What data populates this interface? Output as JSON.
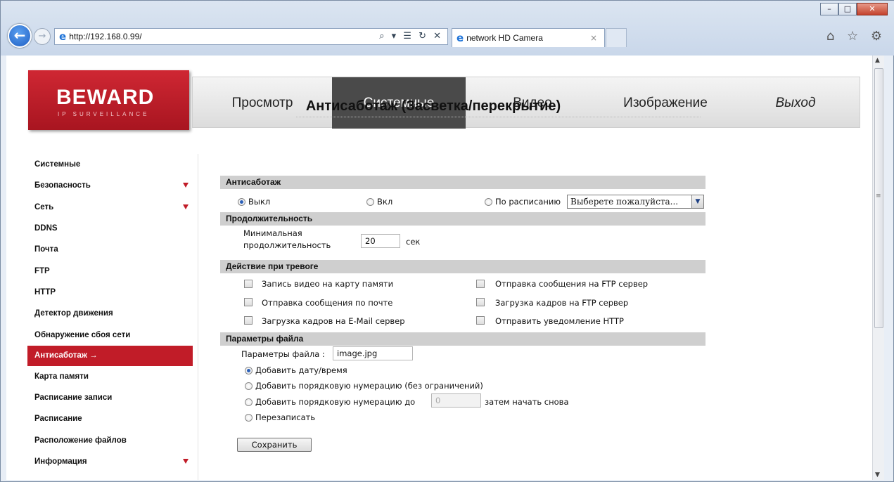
{
  "browser": {
    "url": "http://192.168.0.99/",
    "tab_title": "network HD Camera",
    "tab_close": "×",
    "addr_tools": "⌕ ▾ ☰ ↻ ✕",
    "right_icons": "⌂ ☆ ⚙"
  },
  "logo": {
    "main": "BEWARD",
    "sub": "IP SURVEILLANCE"
  },
  "menu": [
    {
      "label": "Просмотр"
    },
    {
      "label": "Системные"
    },
    {
      "label": "Видео"
    },
    {
      "label": "Изображение"
    },
    {
      "label": "Выход"
    }
  ],
  "sidebar": [
    {
      "label": "Системные",
      "expand": false
    },
    {
      "label": "Безопасность",
      "expand": true
    },
    {
      "label": "Сеть",
      "expand": true
    },
    {
      "label": "DDNS",
      "expand": false
    },
    {
      "label": "Почта",
      "expand": false
    },
    {
      "label": "FTP",
      "expand": false
    },
    {
      "label": "HTTP",
      "expand": false
    },
    {
      "label": "Детектор движения",
      "expand": false
    },
    {
      "label": "Обнаружение сбоя сети",
      "expand": false
    },
    {
      "label": "Антисаботаж →",
      "expand": false
    },
    {
      "label": "Карта памяти",
      "expand": false
    },
    {
      "label": "Расписание записи",
      "expand": false
    },
    {
      "label": "Расписание",
      "expand": false
    },
    {
      "label": "Расположение файлов",
      "expand": false
    },
    {
      "label": "Информация",
      "expand": true
    }
  ],
  "page": {
    "title": "Антисаботаж (Засветка/перекрытие)",
    "sections": {
      "antisabotage": "Антисаботаж",
      "duration": "Продолжительность",
      "alarm_action": "Действие при тревоге",
      "file_params": "Параметры файла"
    },
    "mode": {
      "off": "Выкл",
      "on": "Вкл",
      "schedule": "По расписанию",
      "schedule_select": "Выберете пожалуйста...",
      "selected": "off"
    },
    "duration": {
      "label_line1": "Минимальная",
      "label_line2": "продолжительность",
      "value": "20",
      "unit": "сек"
    },
    "actions": [
      "Запись видео на карту памяти",
      "Отправка сообщения по почте",
      "Загрузка кадров на E-Mail сервер",
      "Отправка сообщения на FTP сервер",
      "Загрузка кадров на FTP сервер",
      "Отправить уведомление HTTP"
    ],
    "file": {
      "label": "Параметры файла :",
      "value": "image.jpg",
      "opt_datetime": "Добавить дату/время",
      "opt_seq_unlimited": "Добавить порядковую нумерацию (без ограничений)",
      "opt_seq_to": "Добавить порядковую нумерацию до",
      "seq_value": "0",
      "then_restart": "затем начать снова",
      "opt_overwrite": "Перезаписать",
      "selected": "datetime"
    },
    "save": "Сохранить"
  },
  "colors": {
    "accent": "#c11c28",
    "active_menu": "#4a4a4a",
    "section_bg": "#cfcfcf"
  }
}
